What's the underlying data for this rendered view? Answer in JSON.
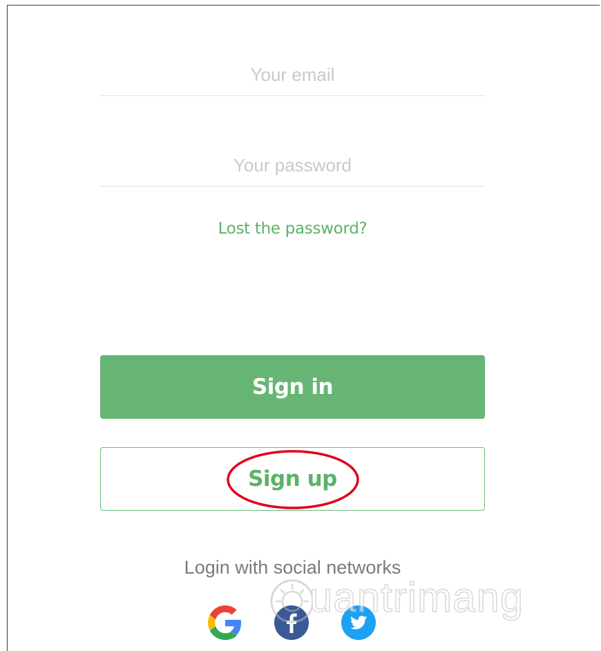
{
  "login_form": {
    "email_placeholder": "Your email",
    "email_value": "",
    "password_placeholder": "Your password",
    "password_value": "",
    "lost_password_link": "Lost the password?",
    "signin_button": "Sign in",
    "signup_button": "Sign up",
    "social_label": "Login with social networks"
  },
  "social_buttons": [
    {
      "name": "google",
      "icon": "google-icon"
    },
    {
      "name": "facebook",
      "icon": "facebook-icon",
      "color": "#3b5998"
    },
    {
      "name": "twitter",
      "icon": "twitter-icon",
      "color": "#1da1f2"
    }
  ],
  "colors": {
    "accent_green": "#67b574",
    "link_green": "#5cb269",
    "annotation_red": "#e0001a"
  },
  "watermark": {
    "text": "uantrimang"
  }
}
